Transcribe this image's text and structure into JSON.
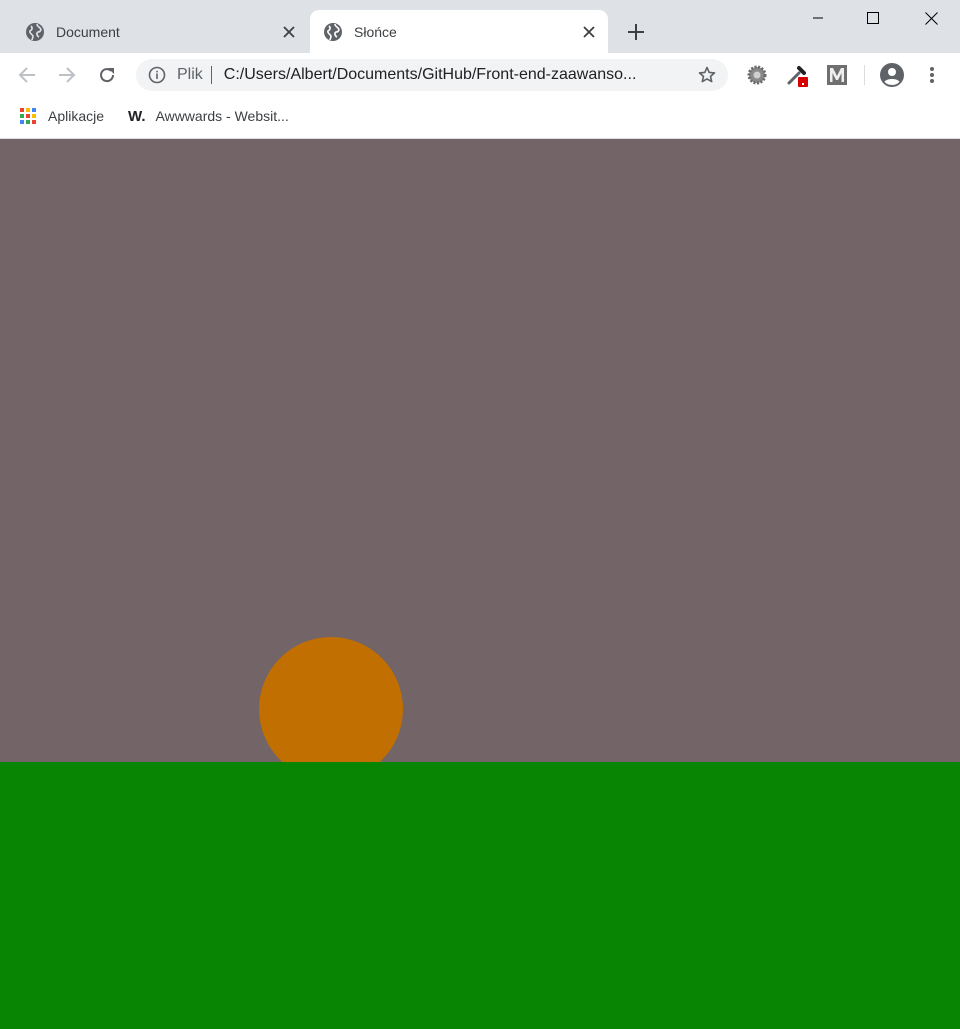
{
  "browser": {
    "tabs": [
      {
        "title": "Document",
        "active": false,
        "icon": "globe-icon"
      },
      {
        "title": "Słońce",
        "active": true,
        "icon": "globe-icon"
      }
    ],
    "omnibox": {
      "scheme_label": "Plik",
      "url": "C:/Users/Albert/Documents/GitHub/Front-end-zaawanso..."
    },
    "bookmarks": [
      {
        "label": "Aplikacje",
        "icon": "apps-grid-icon"
      },
      {
        "label": "Awwwards - Websit...",
        "icon": "awwwards-w-icon"
      }
    ],
    "extensions": [
      "gear-extension-icon",
      "eyedropper-extension-icon",
      "m-extension-icon"
    ]
  },
  "page": {
    "sky_color": "#736467",
    "sun_color": "#c06f00",
    "ground_color": "#088502"
  }
}
